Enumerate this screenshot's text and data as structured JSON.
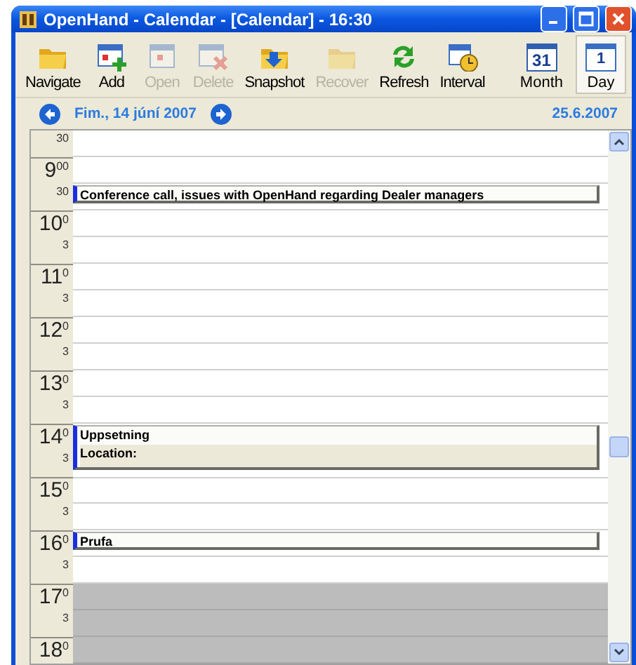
{
  "window": {
    "title": "OpenHand - Calendar - [Calendar] - 16:30"
  },
  "toolbar": [
    {
      "kind": "navigate",
      "label": "Navigate",
      "disabled": false
    },
    {
      "kind": "add",
      "label": "Add",
      "disabled": false
    },
    {
      "kind": "open",
      "label": "Open",
      "disabled": true
    },
    {
      "kind": "delete",
      "label": "Delete",
      "disabled": true
    },
    {
      "kind": "snapshot",
      "label": "Snapshot",
      "disabled": false
    },
    {
      "kind": "recover",
      "label": "Recover",
      "disabled": true
    },
    {
      "kind": "refresh",
      "label": "Refresh",
      "disabled": false
    },
    {
      "kind": "interval",
      "label": "Interval",
      "disabled": false
    }
  ],
  "views": [
    {
      "kind": "month",
      "icon_text": "31",
      "label": "Month",
      "selected": false
    },
    {
      "kind": "day",
      "icon_text": "1",
      "label": "Day",
      "selected": true
    }
  ],
  "date_bar": {
    "current_date": "Fim., 14 júní 2007",
    "today": "25.6.2007"
  },
  "slots": [
    {
      "minute": "30",
      "working": true
    },
    {
      "hour": "9",
      "minute": "00",
      "working": true
    },
    {
      "minute": "30",
      "working": true,
      "event": {
        "lines": [
          "Conference call, issues with OpenHand regarding Dealer managers"
        ]
      }
    },
    {
      "hour": "10",
      "minute": "0",
      "working": true
    },
    {
      "minute": "3",
      "working": true
    },
    {
      "hour": "11",
      "minute": "0",
      "working": true
    },
    {
      "minute": "3",
      "working": true
    },
    {
      "hour": "12",
      "minute": "0",
      "working": true
    },
    {
      "minute": "3",
      "working": true
    },
    {
      "hour": "13",
      "minute": "0",
      "working": true
    },
    {
      "minute": "3",
      "working": true
    },
    {
      "hour": "14",
      "minute": "0",
      "working": true,
      "event": {
        "lines": [
          "Uppsetning",
          "Location:"
        ]
      }
    },
    {
      "minute": "3",
      "working": true
    },
    {
      "hour": "15",
      "minute": "0",
      "working": true
    },
    {
      "minute": "3",
      "working": true
    },
    {
      "hour": "16",
      "minute": "0",
      "working": true,
      "event": {
        "lines": [
          "Prufa"
        ]
      }
    },
    {
      "minute": "3",
      "working": true
    },
    {
      "hour": "17",
      "minute": "0",
      "working": false
    },
    {
      "minute": "3",
      "working": false
    },
    {
      "hour": "18",
      "minute": "0",
      "working": false
    }
  ]
}
